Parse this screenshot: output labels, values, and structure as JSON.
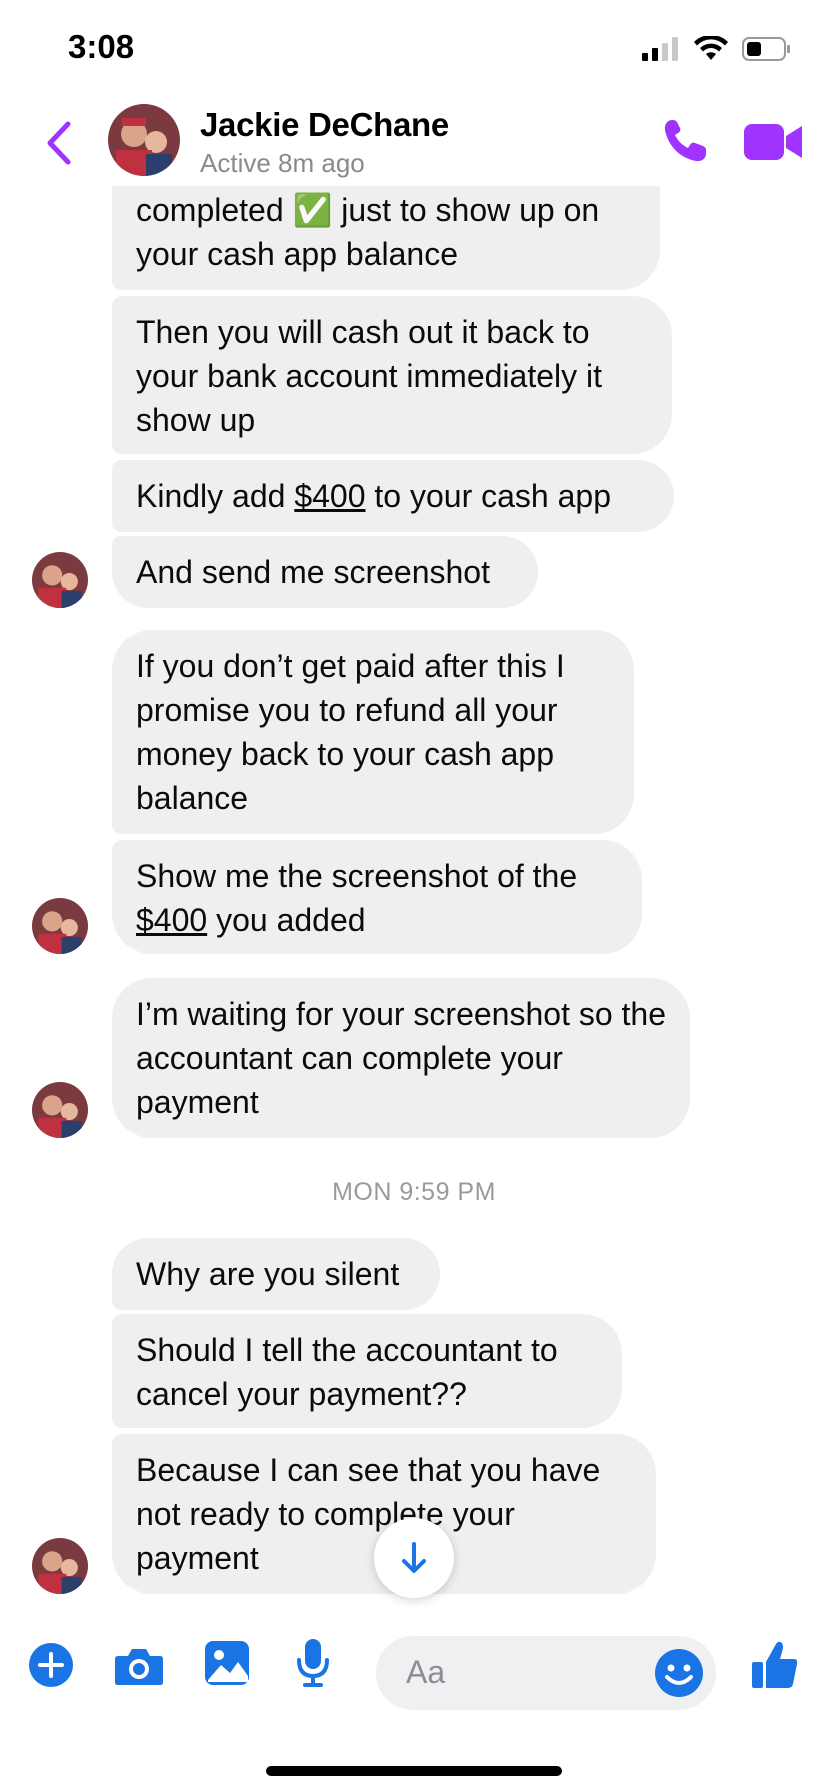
{
  "status": {
    "time": "3:08"
  },
  "header": {
    "name": "Jackie DeChane",
    "active": "Active 8m ago"
  },
  "messages": [
    {
      "line1": "completed ",
      "emoji": "✅",
      "line1b": " just to show up on",
      "line2": "your cash app balance"
    },
    {
      "text": "Then you will cash out it back to your bank account immediately it show up"
    },
    {
      "pre": "Kindly add ",
      "amount": "$400",
      "post": " to your cash app"
    },
    {
      "text": "And send me screenshot"
    },
    {
      "text": "If you don’t get paid after this I promise you to refund all your money back to your cash app balance"
    },
    {
      "pre": "Show me the screenshot of the ",
      "amount": "$400",
      "post": " you added"
    },
    {
      "text": "I’m waiting for your screenshot so the accountant can complete your payment"
    },
    {
      "text": "Why are you silent"
    },
    {
      "text": "Should I tell the accountant to cancel your payment??"
    },
    {
      "text": "Because I can see that you have not ready to complete your payment"
    }
  ],
  "timestamp": "MON 9:59 PM",
  "composer": {
    "placeholder": "Aa"
  },
  "icons": {
    "back": "chevron-left-icon",
    "call": "phone-icon",
    "video": "video-camera-icon",
    "add": "plus-circle-icon",
    "camera": "camera-icon",
    "gallery": "image-icon",
    "mic": "microphone-icon",
    "emoji": "smiley-icon",
    "like": "thumbs-up-icon",
    "scroll": "arrow-down-icon"
  },
  "colors": {
    "accent_purple": "#a033ff",
    "accent_blue": "#1b74e4",
    "bubble": "#efeff1"
  }
}
